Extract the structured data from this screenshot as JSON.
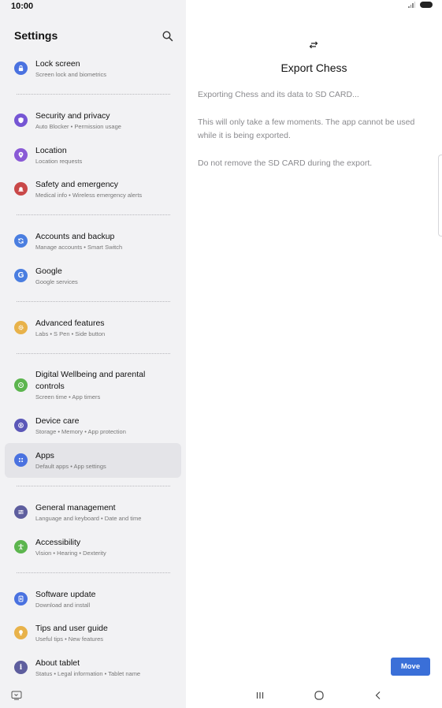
{
  "status": {
    "time": "10:00"
  },
  "settings": {
    "title": "Settings",
    "items": [
      {
        "title": "Lock screen",
        "subtitle": "Screen lock and biometrics",
        "icon": "lock-icon",
        "color": "#4a72e0"
      },
      {
        "title": "Security and privacy",
        "subtitle": "Auto Blocker  •  Permission usage",
        "icon": "shield-icon",
        "color": "#7656d4"
      },
      {
        "title": "Location",
        "subtitle": "Location requests",
        "icon": "location-pin-icon",
        "color": "#8a5ad6"
      },
      {
        "title": "Safety and emergency",
        "subtitle": "Medical info  •  Wireless emergency alerts",
        "icon": "alarm-bell-icon",
        "color": "#c94848"
      },
      {
        "title": "Accounts and backup",
        "subtitle": "Manage accounts  •  Smart Switch",
        "icon": "sync-icon",
        "color": "#4a7ee0"
      },
      {
        "title": "Google",
        "subtitle": "Google services",
        "icon": "google-g-icon",
        "color": "#4a7ee0"
      },
      {
        "title": "Advanced features",
        "subtitle": "Labs  •  S Pen  •  Side button",
        "icon": "gear-plus-icon",
        "color": "#e8b24a"
      },
      {
        "title": "Digital Wellbeing and parental",
        "title2": "controls",
        "subtitle": "Screen time  •  App timers",
        "icon": "wellbeing-icon",
        "color": "#5cb54e"
      },
      {
        "title": "Device care",
        "subtitle": "Storage  •  Memory  •  App protection",
        "icon": "device-care-icon",
        "color": "#5b57b8"
      },
      {
        "title": "Apps",
        "subtitle": "Default apps  •  App settings",
        "icon": "apps-grid-icon",
        "color": "#4a72e0"
      },
      {
        "title": "General management",
        "subtitle": "Language and keyboard  •  Date and time",
        "icon": "sliders-icon",
        "color": "#5e5e9e"
      },
      {
        "title": "Accessibility",
        "subtitle": "Vision  •  Hearing  •  Dexterity",
        "icon": "accessibility-person-icon",
        "color": "#5cb54e"
      },
      {
        "title": "Software update",
        "subtitle": "Download and install",
        "icon": "software-update-icon",
        "color": "#4a72e0"
      },
      {
        "title": "Tips and user guide",
        "subtitle": "Useful tips  •  New features",
        "icon": "lightbulb-icon",
        "color": "#e8b24a"
      },
      {
        "title": "About tablet",
        "subtitle": "Status  •  Legal information  •  Tablet name",
        "icon": "info-icon",
        "color": "#5e5e9e"
      }
    ]
  },
  "export": {
    "title": "Export Chess",
    "line1": "Exporting Chess and its data to SD CARD...",
    "line2": "This will only take a few moments. The app cannot be used while it is being exported.",
    "line3": "Do not remove the SD CARD during the export.",
    "move_label": "Move"
  }
}
